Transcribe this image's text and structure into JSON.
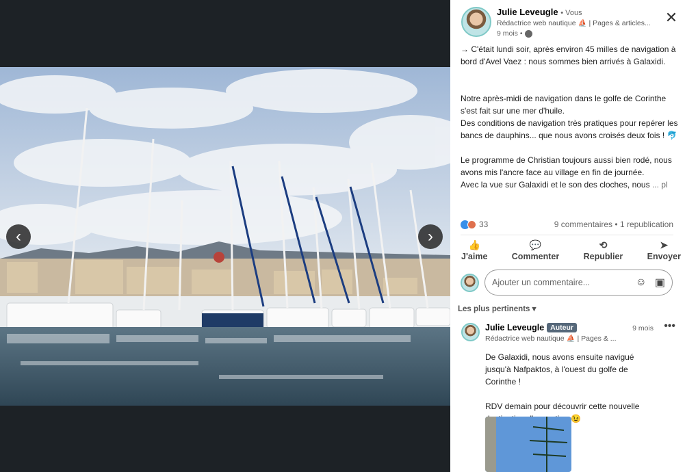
{
  "viewer": {
    "prev_icon": "chevron-left-icon",
    "next_icon": "chevron-right-icon",
    "prev_glyph": "‹",
    "next_glyph": "›"
  },
  "author": {
    "name": "Julie Leveugle",
    "you": "• Vous",
    "headline": "Rédactrice web nautique ⛵ | Pages & articles...",
    "time": "9 mois •",
    "visibility_icon": "globe-icon"
  },
  "close": {
    "glyph": "✕"
  },
  "post": {
    "p1": "→ C'était lundi soir, après environ 45 milles de navigation à bord d'Avel Vaez : nous sommes bien arrivés à Galaxidi.",
    "p2": "Notre après-midi de navigation dans le golfe de Corinthe s'est fait sur une mer d'huile.",
    "p3": "Des conditions de navigation très pratiques pour repérer les bancs de dauphins... que nous avons croisés deux fois ! 🐬",
    "p4": "Le programme de Christian toujours aussi bien rodé, nous avons mis l'ancre face au village en fin de journée.",
    "p5": "Avec la vue sur Galaxidi et le son des cloches, nous",
    "more": "... pl"
  },
  "reactions": {
    "count": "33",
    "comments": "9 commentaires",
    "reposts": "• 1 republication"
  },
  "actions": [
    {
      "label": "J'aime",
      "icon": "like-icon",
      "glyph": "👍"
    },
    {
      "label": "Commenter",
      "icon": "comment-icon",
      "glyph": "💬"
    },
    {
      "label": "Republier",
      "icon": "repost-icon",
      "glyph": "⟲"
    },
    {
      "label": "Envoyer",
      "icon": "send-icon",
      "glyph": "➤"
    }
  ],
  "comment_box": {
    "placeholder": "Ajouter un commentaire...",
    "emoji_glyph": "☺",
    "image_glyph": "▣"
  },
  "sort": {
    "label": "Les plus pertinents ▾"
  },
  "comment": {
    "name": "Julie Leveugle",
    "badge": "Auteur",
    "headline": "Rédactrice web nautique ⛵ | Pages & ...",
    "time": "9 mois",
    "menu": "•••",
    "text1": "De Galaxidi, nous avons ensuite navigué jusqu'à Nafpaktos, à l'ouest du golfe de Corinthe !",
    "text2": "RDV demain pour découvrir cette nouvelle destination d'exception 😉"
  }
}
